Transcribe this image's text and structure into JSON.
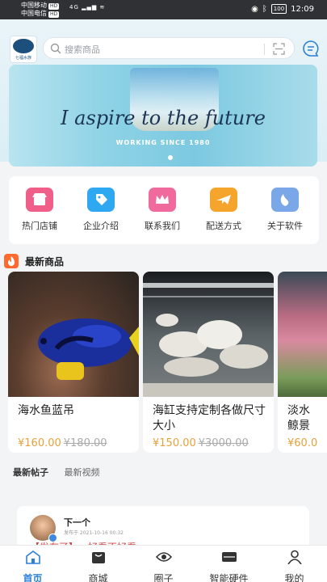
{
  "status_bar": {
    "carrier1": "中国移动",
    "carrier2": "中国电信",
    "hd": "HD",
    "network": "4G",
    "battery": "100",
    "time": "12:09"
  },
  "header": {
    "logo_text": "七福水族",
    "search_placeholder": "搜索商品"
  },
  "banner": {
    "title": "I aspire to the future",
    "subtitle": "WORKING SINCE 1980"
  },
  "quick_menu": [
    {
      "label": "热门店铺",
      "icon": "shop-icon",
      "color": "#ef5f8a"
    },
    {
      "label": "企业介绍",
      "icon": "tag-icon",
      "color": "#2ea8f0"
    },
    {
      "label": "联系我们",
      "icon": "crown-icon",
      "color": "#f06a9e"
    },
    {
      "label": "配送方式",
      "icon": "plane-icon",
      "color": "#f6a52c"
    },
    {
      "label": "关于软件",
      "icon": "leaf-icon",
      "color": "#7aa7e8"
    }
  ],
  "new_goods": {
    "title": "最新商品",
    "items": [
      {
        "name": "海水鱼蓝吊",
        "price": "¥160.00",
        "old_price": "¥180.00"
      },
      {
        "name": "海缸支持定制各做尺寸大小",
        "price": "¥150.00",
        "old_price": "¥3000.00"
      },
      {
        "name": "淡水鲸景",
        "price": "¥60.0",
        "old_price": ""
      }
    ]
  },
  "post_tabs": [
    "最新帖子",
    "最新视频"
  ],
  "post": {
    "author": "下一个",
    "meta": "发布于 2021-10-16 00:32",
    "text": "【发布了】 - 好看不好看"
  },
  "bottom_nav": [
    {
      "label": "首页",
      "icon": "home-icon"
    },
    {
      "label": "商城",
      "icon": "bag-icon"
    },
    {
      "label": "圈子",
      "icon": "circle-icon"
    },
    {
      "label": "智能硬件",
      "icon": "device-icon"
    },
    {
      "label": "我的",
      "icon": "user-icon"
    }
  ],
  "colors": {
    "accent": "#2b80d6",
    "price": "#e8a13b"
  }
}
